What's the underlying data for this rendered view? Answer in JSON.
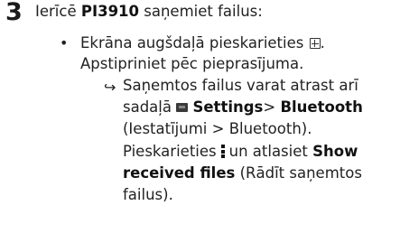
{
  "step": {
    "number": "3",
    "intro_prefix": "Ierīcē ",
    "device": "PI3910",
    "intro_suffix": " saņemiet failus:"
  },
  "bullet": {
    "marker": "•",
    "line1_prefix": "Ekrāna augšdaļā pieskarieties ",
    "line1_icon": "grid-icon",
    "line1_suffix": ".",
    "line2": "Apstipriniet pēc pieprasījuma."
  },
  "result": {
    "marker": "↪",
    "line1": "Saņemtos failus varat atrast arī",
    "line2_prefix": "sadaļā ",
    "line2_icon": "settings-icon",
    "settings_label": "Settings",
    "separator": "> ",
    "bluetooth_label": "Bluetooth",
    "line3": "(Iestatījumi > Bluetooth).",
    "line4_prefix": "Pieskarieties",
    "line4_icon": "menu-icon",
    "line4_mid": "un atlasiet ",
    "show_label": "Show",
    "received_label": "received files",
    "line5_suffix": " (Rādīt saņemtos",
    "line6": "failus)."
  }
}
